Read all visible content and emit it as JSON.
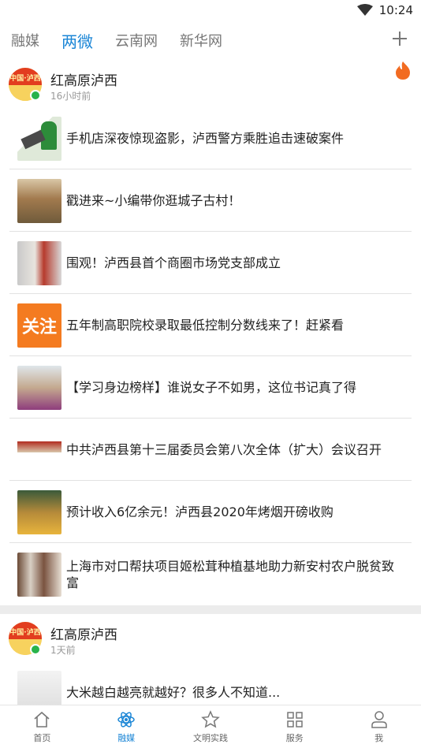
{
  "status_bar": {
    "time": "10:24"
  },
  "top_tabs": [
    {
      "label": "融媒",
      "active": false
    },
    {
      "label": "两微",
      "active": true
    },
    {
      "label": "云南网",
      "active": false
    },
    {
      "label": "新华网",
      "active": false
    }
  ],
  "feed": {
    "cards": [
      {
        "source": "红高原泸西",
        "time": "16小时前",
        "items": [
          {
            "title": "手机店深夜惊现盗影，泸西警方乘胜追击速破案件"
          },
          {
            "title": "戳进来~小编带你逛城子古村！"
          },
          {
            "title": "围观！泸西县首个商圈市场党支部成立"
          },
          {
            "title": "五年制高职院校录取最低控制分数线来了！赶紧看",
            "thumb_text": "关注"
          },
          {
            "title": "【学习身边榜样】谁说女子不如男，这位书记真了得"
          },
          {
            "title": "中共泸西县第十三届委员会第八次全体（扩大）会议召开"
          },
          {
            "title": "预计收入6亿余元！泸西县2020年烤烟开磅收购"
          },
          {
            "title": "上海市对口帮扶项目姬松茸种植基地助力新安村农户脱贫致富"
          }
        ]
      },
      {
        "source": "红高原泸西",
        "time": "1天前",
        "items": [
          {
            "title": "大米越白越亮就越好？很多人不知道..."
          }
        ]
      }
    ]
  },
  "bottom_nav": [
    {
      "label": "首页",
      "icon": "home-icon",
      "active": false
    },
    {
      "label": "融媒",
      "icon": "atom-icon",
      "active": true
    },
    {
      "label": "文明实践",
      "icon": "star-icon",
      "active": false
    },
    {
      "label": "服务",
      "icon": "grid-icon",
      "active": false
    },
    {
      "label": "我",
      "icon": "user-icon",
      "active": false
    }
  ],
  "colors": {
    "accent": "#1b86d6",
    "fire": "#f26b21"
  }
}
